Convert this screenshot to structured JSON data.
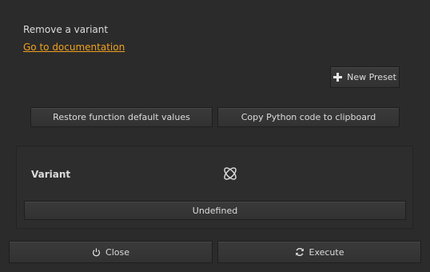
{
  "dialog": {
    "description": "Remove a variant",
    "doc_link": "Go to documentation"
  },
  "presets": {
    "new_preset_label": "New Preset",
    "new_preset_icon": "plus-icon"
  },
  "defaults": {
    "restore_label": "Restore function default values",
    "copy_python_label": "Copy Python code to clipboard"
  },
  "variant_group": {
    "label": "Variant",
    "icon": "variant-icon",
    "value": "Undefined"
  },
  "footer": {
    "close_label": "Close",
    "close_icon": "power-icon",
    "execute_label": "Execute",
    "execute_icon": "refresh-icon"
  },
  "colors": {
    "background": "#2b2b2b",
    "link": "#f0a020",
    "button": "#363636"
  }
}
